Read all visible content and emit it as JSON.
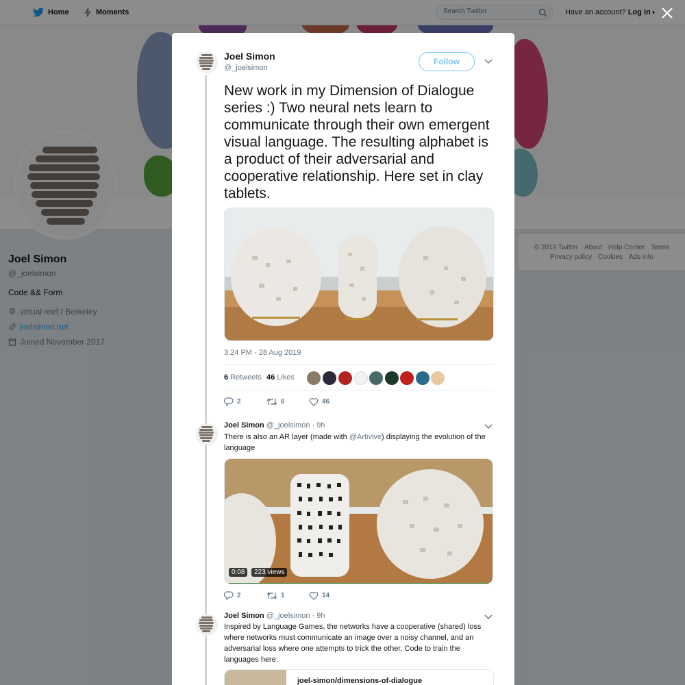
{
  "nav": {
    "home": "Home",
    "moments": "Moments",
    "search_placeholder": "Search Twitter",
    "have_account": "Have an account?",
    "login": "Log in"
  },
  "profile": {
    "name": "Joel Simon",
    "handle": "@_joelsimon",
    "bio": "Code && Form",
    "location": "virtual reef / Berkeley",
    "website": "joelsimon.net",
    "joined": "Joined November 2017"
  },
  "footer": {
    "row1": [
      "© 2019 Twitter",
      "About",
      "Help Center",
      "Terms"
    ],
    "row2": [
      "Privacy policy",
      "Cookies",
      "Ads info"
    ]
  },
  "tweet": {
    "name": "Joel Simon",
    "handle": "@_joelsimon",
    "follow": "Follow",
    "text": "New work in my Dimension of Dialogue series :) Two neural nets learn to communicate through their own emergent visual language. The resulting alphabet is a product of their adversarial and cooperative relationship. Here set in clay tablets.",
    "timestamp": "3:24 PM - 28 Aug 2019",
    "retweets_count": "6",
    "retweets_label": "Retweets",
    "likes_count": "46",
    "likes_label": "Likes",
    "replies": "2",
    "retweets": "6",
    "likes": "46"
  },
  "reply1": {
    "name": "Joel Simon",
    "handle": "@_joelsimon",
    "time": "· 9h",
    "text_before": "There is also an AR layer (made with ",
    "mention": "@Artivive",
    "text_after": ") displaying the evolution of the language",
    "video_time": "0:08",
    "video_views": "223 views",
    "replies": "2",
    "retweets": "1",
    "likes": "14"
  },
  "reply2": {
    "name": "Joel Simon",
    "handle": "@_joelsimon",
    "time": "· 9h",
    "text": "Inspired by Language Games, the networks have a cooperative (shared) loss where networks must communicate an image over a noisy channel, and an adversarial loss where one attempts to trick the other. Code to train the languages here:",
    "card_title": "joel-simon/dimensions-of-dialogue"
  },
  "colors": {
    "twitter_blue": "#1da1f2",
    "muted_text": "#657786",
    "background": "#e6ecf0"
  },
  "icons": [
    "twitter-bird-icon",
    "moments-icon",
    "search-icon",
    "close-icon",
    "location-icon",
    "link-icon",
    "calendar-icon",
    "chevron-down-icon",
    "reply-icon",
    "retweet-icon",
    "heart-icon"
  ]
}
